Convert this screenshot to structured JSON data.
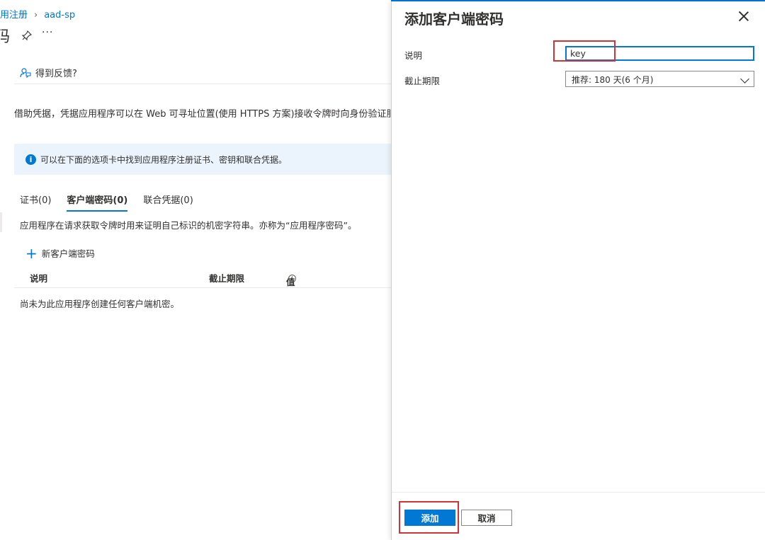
{
  "breadcrumb": {
    "item1": "用注册",
    "item2": "aad-sp"
  },
  "page_title_fragment": "码",
  "header_more": "···",
  "feedback": {
    "label": "得到反馈?"
  },
  "description": "借助凭据，凭据应用程序可以在 Web 可寻址位置(使用 HTTPS 方案)接收令牌时向身份验证服务标识自己",
  "info_bar": {
    "text": "可以在下面的选项卡中找到应用程序注册证书、密钥和联合凭据。"
  },
  "tabs": [
    {
      "label": "证书(0)",
      "active": false
    },
    {
      "label": "客户端密码(0)",
      "active": true
    },
    {
      "label": "联合凭据(0)",
      "active": false
    }
  ],
  "tab_description": "应用程序在请求获取令牌时用来证明自己标识的机密字符串。亦称为“应用程序密码”。",
  "new_secret_label": "新客户端密码",
  "table": {
    "columns": [
      "说明",
      "截止期限",
      "值"
    ],
    "empty_text": "尚未为此应用程序创建任何客户端机密。"
  },
  "panel": {
    "title": "添加客户端密码",
    "description_label": "说明",
    "description_value": "key",
    "expires_label": "截止期限",
    "expires_value": "推荐: 180 天(6 个月)",
    "add_button": "添加",
    "cancel_button": "取消"
  },
  "colors": {
    "accent": "#0078d4",
    "highlight": "#d13438",
    "info_bg": "#ebf3fc"
  }
}
